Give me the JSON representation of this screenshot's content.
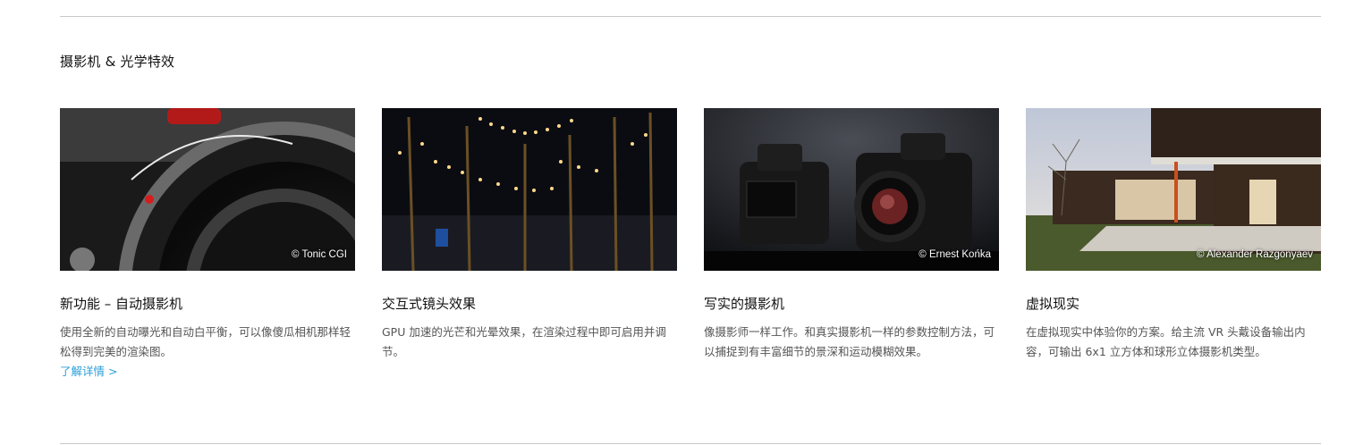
{
  "section": {
    "title": "摄影机 & 光学特效"
  },
  "cards": [
    {
      "title": "新功能 – 自动摄影机",
      "description": "使用全新的自动曝光和自动白平衡，可以像傻瓜相机那样轻松得到完美的渲染图。",
      "credit": "© Tonic CGI",
      "link": "了解详情 >",
      "image_icon": "camera-lens-closeup"
    },
    {
      "title": "交互式镜头效果",
      "description": "GPU 加速的光芒和光晕效果，在渲染过程中即可启用并调节。",
      "credit": "",
      "image_icon": "night-string-lights-scene"
    },
    {
      "title": "写实的摄影机",
      "description": "像摄影师一样工作。和真实摄影机一样的参数控制方法，可以捕捉到有丰富细节的景深和运动模糊效果。",
      "credit": "© Ernest Końka",
      "image_icon": "dslr-cameras"
    },
    {
      "title": "虚拟现实",
      "description": "在虚拟现实中体验你的方案。给主流 VR 头戴设备输出内容，可输出 6x1 立方体和球形立体摄影机类型。",
      "credit": "© Alexander Razgonyaev",
      "image_icon": "modern-house-dusk"
    }
  ]
}
